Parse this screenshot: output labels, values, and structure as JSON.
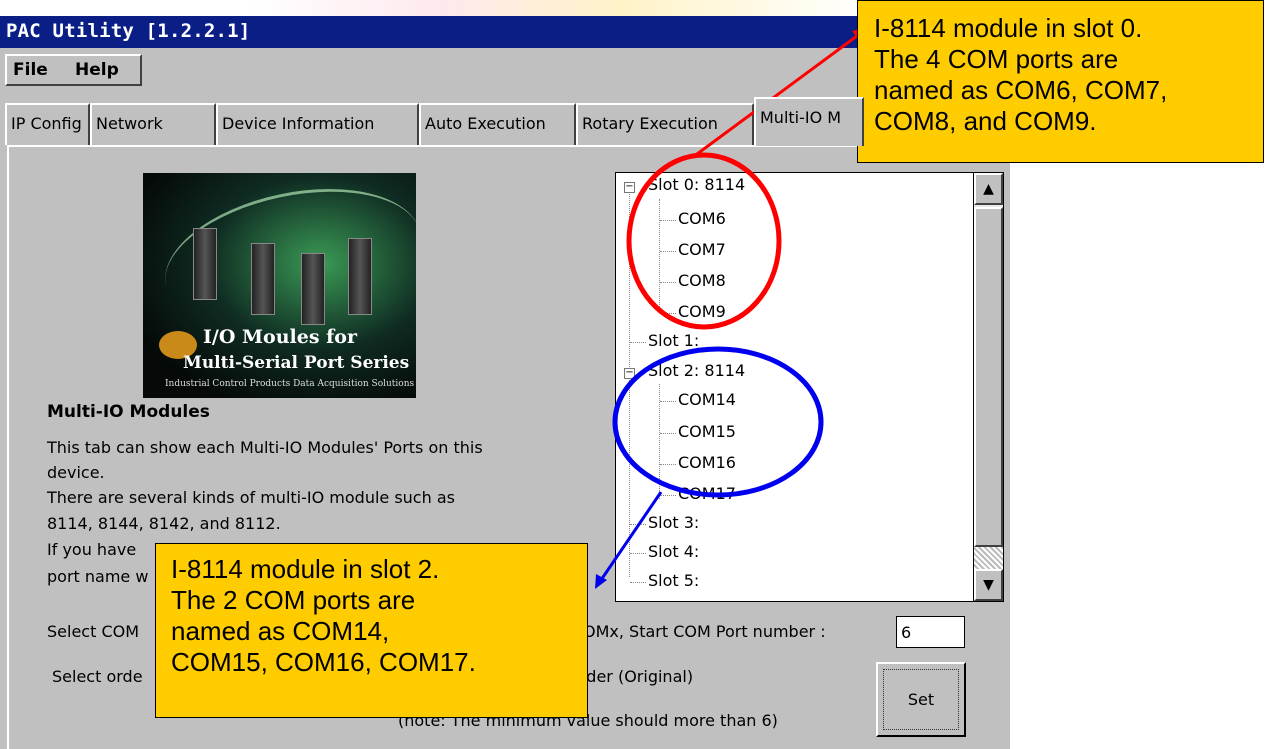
{
  "window": {
    "title": "PAC Utility  [1.2.2.1]"
  },
  "menu": {
    "file": "File",
    "help": "Help"
  },
  "tabs": [
    "IP Config",
    "Network",
    "Device Information",
    "Auto Execution",
    "Rotary Execution",
    "Multi-IO M"
  ],
  "promo": {
    "line1": "I/O Moules for",
    "line2": "Multi-Serial Port Series",
    "line3": "Industrial Control Products  Data Acquisition Solutions"
  },
  "description": {
    "heading": "Multi-IO Modules",
    "lines": [
      "This tab can show each Multi-IO Modules' Ports on this",
      "device.",
      "There are several kinds of multi-IO module such as",
      "8114, 8144, 8142, and 8112.",
      "If you have",
      "port name w"
    ]
  },
  "tree": {
    "nodes": [
      {
        "label": "Slot 0: 8114",
        "level": 0,
        "expander": "minus"
      },
      {
        "label": "COM6",
        "level": 1
      },
      {
        "label": "COM7",
        "level": 1
      },
      {
        "label": "COM8",
        "level": 1
      },
      {
        "label": "COM9",
        "level": 1
      },
      {
        "label": "Slot 1:",
        "level": 0
      },
      {
        "label": "Slot 2: 8114",
        "level": 0,
        "expander": "minus"
      },
      {
        "label": "COM14",
        "level": 1
      },
      {
        "label": "COM15",
        "level": 1
      },
      {
        "label": "COM16",
        "level": 1
      },
      {
        "label": "COM17",
        "level": 1
      },
      {
        "label": "Slot 3:",
        "level": 0
      },
      {
        "label": "Slot 4:",
        "level": 0
      },
      {
        "label": "Slot 5:",
        "level": 0
      }
    ]
  },
  "settings": {
    "select_com_prefix": "Select COM",
    "start_com_label": "OMx, Start COM Port number :",
    "start_com_value": "6",
    "select_order_prefix": "Select orde",
    "order_value": "rder (Original)",
    "note": "(note: The minimum value should more than 6)",
    "set_label": "Set"
  },
  "callouts": {
    "top": [
      "I-8114 module in slot 0.",
      "The 4 COM ports are",
      "named as COM6, COM7,",
      "COM8, and COM9."
    ],
    "bottom": [
      "I-8114 module in slot 2.",
      "The 2 COM ports are",
      "named as COM14,",
      "COM15, COM16, COM17."
    ]
  },
  "colors": {
    "titlebar": "#0a1e86",
    "callout": "#ffcc00",
    "slot0_circle": "#ff0000",
    "slot2_circle": "#0000ee"
  }
}
